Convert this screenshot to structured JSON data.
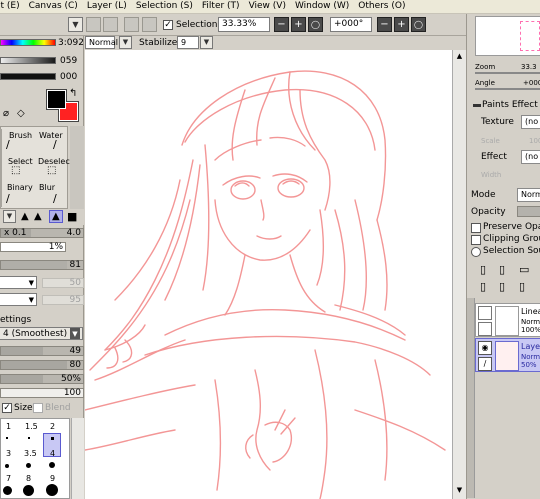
{
  "menubar": {
    "items": [
      "it (E)",
      "Canvas (C)",
      "Layer (L)",
      "Selection (S)",
      "Filter (T)",
      "View (V)",
      "Window (W)",
      "Others (O)"
    ]
  },
  "toolbar": {
    "selection_label": "Selection",
    "zoom_value": "33.33%",
    "rotate_value": "+000°"
  },
  "leftpanel": {
    "color_value_1": "3:092",
    "color_value_2": "059",
    "color_value_3": "000",
    "blend_mode": "Normal",
    "stabilizer_label": "Stabilizer",
    "stabilizer_value": "9",
    "tools": [
      {
        "label": "Brush"
      },
      {
        "label": "Water"
      },
      {
        "label": "Select"
      },
      {
        "label": "Deselect"
      },
      {
        "label": "Binary"
      },
      {
        "label": "Blur"
      }
    ],
    "size_multiplier": "x 0.1",
    "size_value": "4.0",
    "min_size": "1%",
    "density": "81",
    "faded_1": "50",
    "faded_2": "95",
    "settings_label": "ettings",
    "smoothing": "4 (Smoothest)",
    "row_values": [
      "49",
      "80",
      "50%",
      "100"
    ],
    "size_check_label": "Size",
    "blend_check_label": "Blend",
    "brush_sizes": [
      [
        "1",
        "1.5",
        "2"
      ],
      [
        "",
        "",
        ""
      ],
      [
        "3",
        "3.5",
        "4"
      ],
      [
        "",
        "",
        ""
      ],
      [
        "7",
        "8",
        "9"
      ]
    ]
  },
  "rightpanel": {
    "zoom_label": "Zoom",
    "zoom_value": "33.3",
    "angle_label": "Angle",
    "angle_value": "+000",
    "paints_effect": "Paints Effect",
    "texture_label": "Texture",
    "texture_value": "(no",
    "scale_label": "Scale",
    "scale_value": "100",
    "effect_label": "Effect",
    "effect_value": "(no",
    "width_label": "Width",
    "mode_label": "Mode",
    "mode_value": "Norm",
    "opacity_label": "Opacity",
    "preserve_opacity": "Preserve Opaci",
    "clipping_group": "Clipping Group",
    "selection_source": "Selection Sourc",
    "layers": [
      {
        "name": "Linea",
        "mode": "Norma",
        "opacity": "100%",
        "selected": false
      },
      {
        "name": "Layer",
        "mode": "Norma",
        "opacity": "50%",
        "selected": true
      }
    ]
  },
  "colors": {
    "sketch_stroke": "#f28b8b",
    "primary": "#000000",
    "secondary": "#ff2222",
    "selected_layer_bg": "#c8c8f4"
  }
}
